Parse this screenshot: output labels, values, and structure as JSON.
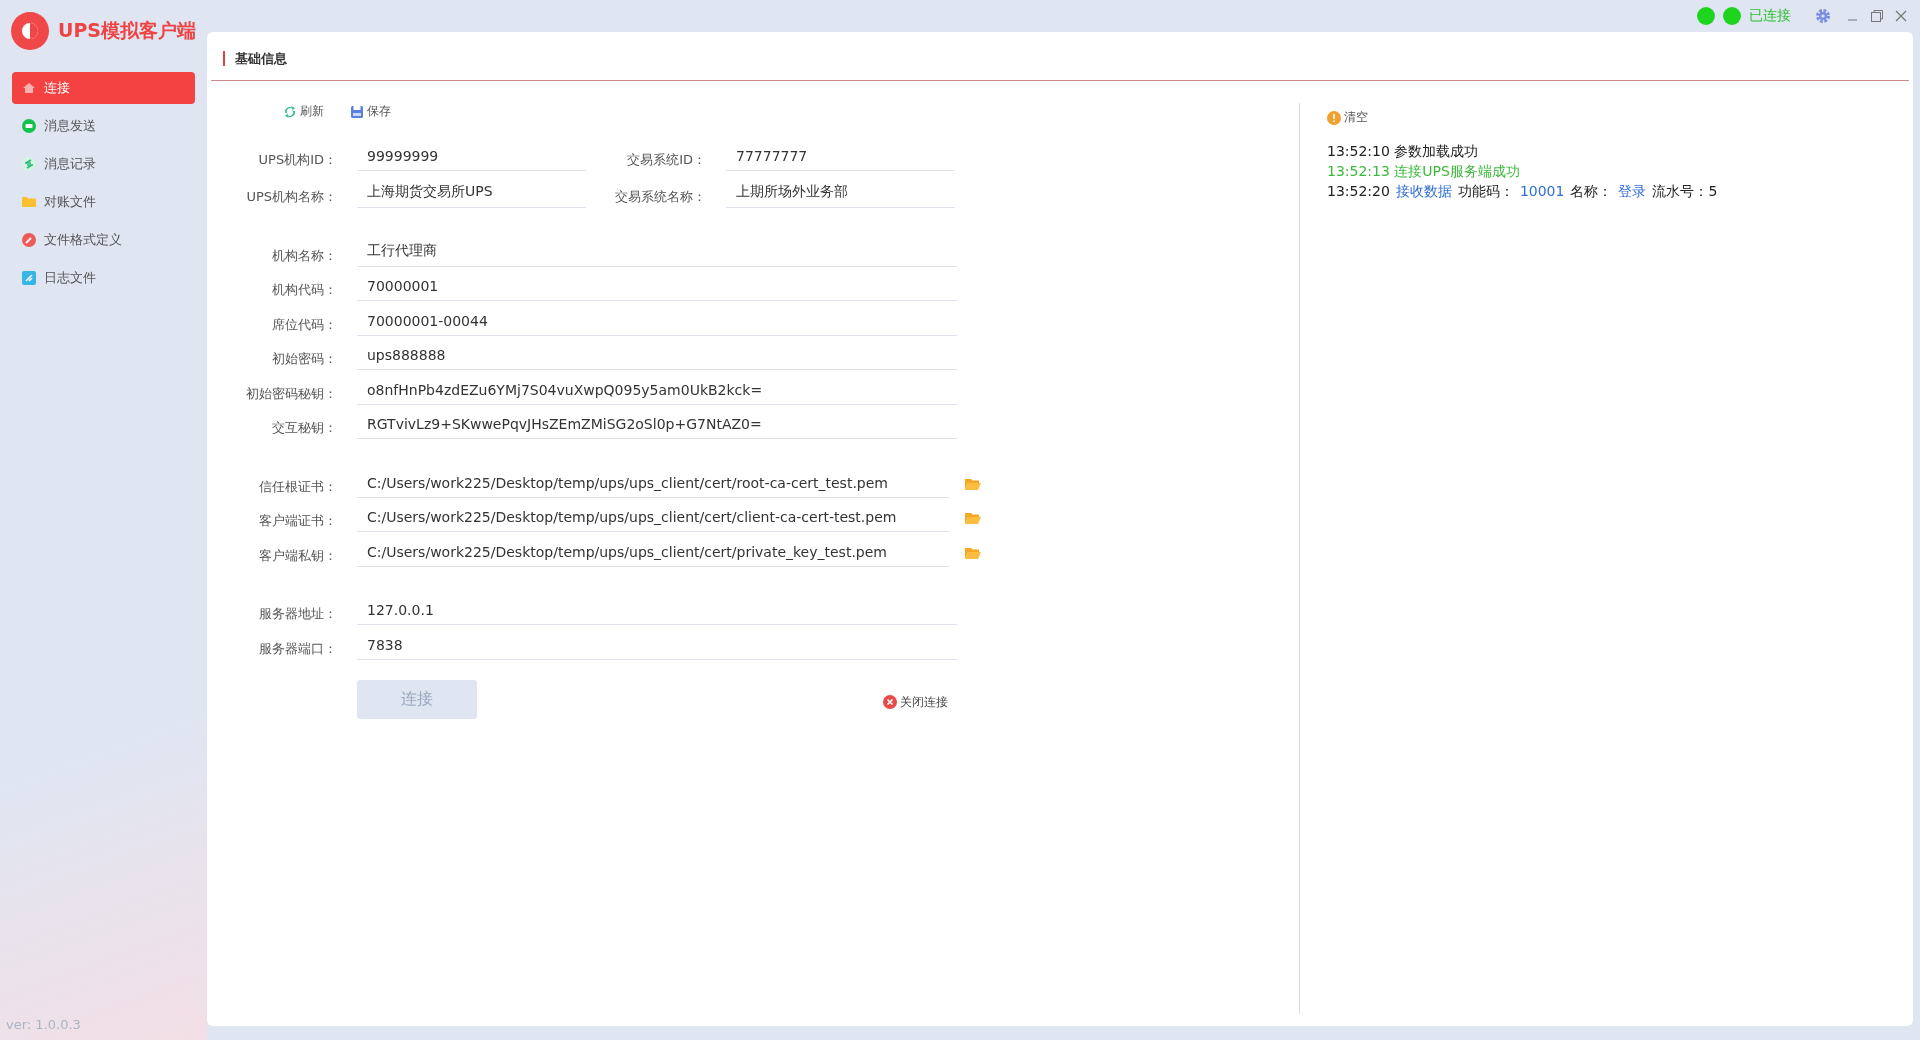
{
  "app": {
    "title": "UPS模拟客户端",
    "version": "ver: 1.0.0.3"
  },
  "status": {
    "connected": true,
    "label": "已连接"
  },
  "sidebar": {
    "items": [
      {
        "label": "连接",
        "selected": true
      },
      {
        "label": "消息发送",
        "selected": false
      },
      {
        "label": "消息记录",
        "selected": false
      },
      {
        "label": "对账文件",
        "selected": false
      },
      {
        "label": "文件格式定义",
        "selected": false
      },
      {
        "label": "日志文件",
        "selected": false
      }
    ]
  },
  "panel": {
    "title": "基础信息"
  },
  "toolbar": [
    {
      "label": "刷新"
    },
    {
      "label": "保存"
    }
  ],
  "top_rows": [
    {
      "left": {
        "label": "UPS机构ID：",
        "value": "99999999"
      },
      "right": {
        "label": "交易系统ID：",
        "value": "77777777"
      }
    },
    {
      "left": {
        "label": "UPS机构名称：",
        "value": "上海期货交易所UPS"
      },
      "right": {
        "label": "交易系统名称：",
        "value": "上期所场外业务部"
      }
    }
  ],
  "field_groups": [
    [
      {
        "label": "机构名称：",
        "value": "工行代理商",
        "browse": false
      },
      {
        "label": "机构代码：",
        "value": "70000001",
        "browse": false
      },
      {
        "label": "席位代码：",
        "value": "70000001-00044",
        "browse": false
      },
      {
        "label": "初始密码：",
        "value": "ups888888",
        "browse": false
      },
      {
        "label": "初始密码秘钥：",
        "value": "o8nfHnPb4zdEZu6YMj7S04vuXwpQ095y5am0UkB2kck=",
        "browse": false
      },
      {
        "label": "交互秘钥：",
        "value": "RGTvivLz9+SKwwePqvJHsZEmZMiSG2oSl0p+G7NtAZ0=",
        "browse": false
      }
    ],
    [
      {
        "label": "信任根证书：",
        "value": "C:/Users/work225/Desktop/temp/ups/ups_client/cert/root-ca-cert_test.pem",
        "browse": true
      },
      {
        "label": "客户端证书：",
        "value": "C:/Users/work225/Desktop/temp/ups/ups_client/cert/client-ca-cert-test.pem",
        "browse": true
      },
      {
        "label": "客户端私钥：",
        "value": "C:/Users/work225/Desktop/temp/ups/ups_client/cert/private_key_test.pem",
        "browse": true
      }
    ],
    [
      {
        "label": "服务器地址：",
        "value": "127.0.0.1",
        "browse": false
      },
      {
        "label": "服务器端口：",
        "value": "7838",
        "browse": false
      }
    ]
  ],
  "connect_button": {
    "label": "连接",
    "disabled": true
  },
  "disconnect_link": {
    "label": "关闭连接"
  },
  "log": {
    "clear_label": "清空",
    "lines": [
      {
        "segments": [
          {
            "text": "13:52:10 参数加载成功",
            "color": "#222222"
          }
        ]
      },
      {
        "segments": [
          {
            "text": "13:52:13 连接UPS服务端成功",
            "color": "#3cb93c"
          }
        ]
      },
      {
        "segments": [
          {
            "text": "13:52:20",
            "color": "#222222"
          },
          {
            "text": "接收数据",
            "color": "#2f6fd6"
          },
          {
            "text": "功能码：",
            "color": "#222222"
          },
          {
            "text": "10001",
            "color": "#2f6fd6"
          },
          {
            "text": "名称：",
            "color": "#222222"
          },
          {
            "text": "登录",
            "color": "#2f6fd6"
          },
          {
            "text": "流水号：5",
            "color": "#222222"
          }
        ]
      }
    ]
  }
}
